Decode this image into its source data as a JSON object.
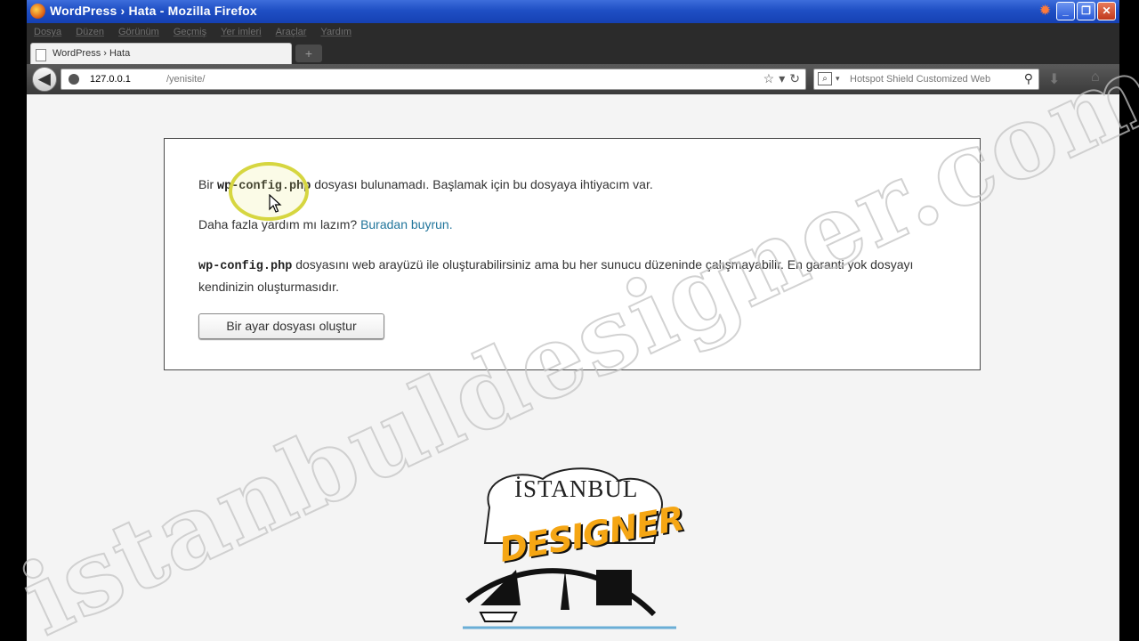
{
  "window": {
    "title": "WordPress › Hata - Mozilla Firefox",
    "controls": {
      "minimize": "_",
      "maximize": "❐",
      "close": "✕"
    }
  },
  "menu": {
    "items": [
      "Dosya",
      "Düzen",
      "Görünüm",
      "Geçmiş",
      "Yer imleri",
      "Araçlar",
      "Yardım"
    ]
  },
  "tab": {
    "label": "WordPress › Hata",
    "new_tab": "+"
  },
  "nav": {
    "url_host": "127.0.0.1",
    "url_path": "/yenisite/",
    "search_placeholder": "Hotspot Shield Customized Web"
  },
  "page": {
    "p1_pre": "Bir ",
    "p1_code": "wp-config.php",
    "p1_post": " dosyası bulunamadı. Başlamak için bu dosyaya ihtiyacım var.",
    "p2_pre": "Daha fazla yardım mı lazım? ",
    "p2_link": "Buradan buyrun.",
    "p3_code": "wp-config.php",
    "p3_post": " dosyasını web arayüzü ile oluşturabilirsiniz ama bu her sunucu düzeninde çalışmayabilir. En garanti yok dosyayı kendinizin oluşturmasıdır.",
    "button_label": "Bir ayar dosyası oluştur"
  },
  "overlay": {
    "watermark": "istanbuldesigner.com",
    "logo_top": "İSTANBUL",
    "logo_main": "DESIGNER"
  },
  "colors": {
    "titlebar": "#1f4fc4",
    "link": "#21759b",
    "logo_accent": "#f5a614"
  }
}
